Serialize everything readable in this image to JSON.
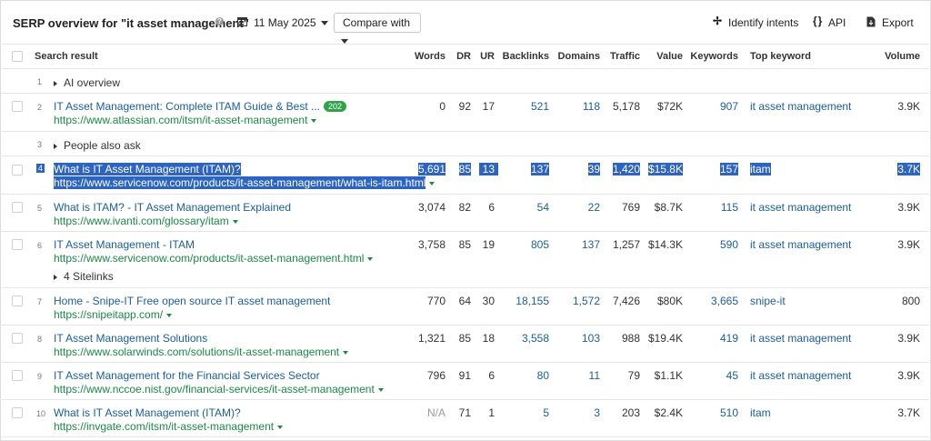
{
  "header": {
    "title": "SERP overview for \"it asset management\"",
    "help_icon": "question-icon",
    "date": "11 May 2025",
    "compare_label": "Compare with",
    "identify_label": "Identify intents",
    "api_label": "API",
    "export_label": "Export"
  },
  "columns": {
    "search_result": "Search result",
    "words": "Words",
    "dr": "DR",
    "ur": "UR",
    "backlinks": "Backlinks",
    "domains": "Domains",
    "traffic": "Traffic",
    "value": "Value",
    "keywords": "Keywords",
    "top_keyword": "Top keyword",
    "volume": "Volume"
  },
  "rows": {
    "r1": {
      "pos": "1",
      "label": "AI overview"
    },
    "r2": {
      "pos": "2",
      "title": "IT Asset Management: Complete ITAM Guide & Best ...",
      "badge": "202",
      "url": "https://www.atlassian.com/itsm/it-asset-management",
      "words": "0",
      "dr": "92",
      "ur": "17",
      "backlinks": "521",
      "domains": "118",
      "traffic": "5,178",
      "value": "$72K",
      "keywords": "907",
      "top_keyword": "it asset management",
      "volume": "3.9K"
    },
    "r3": {
      "pos": "3",
      "label": "People also ask"
    },
    "r4": {
      "pos": "4",
      "title": "What is IT Asset Management (ITAM)?",
      "url": "https://www.servicenow.com/products/it-asset-management/what-is-itam.html",
      "words": "5,691",
      "dr": "85",
      "ur": "13",
      "backlinks": "137",
      "domains": "39",
      "traffic": "1,420",
      "value": "$15.8K",
      "keywords": "157",
      "top_keyword": "itam",
      "volume": "3.7K"
    },
    "r5": {
      "pos": "5",
      "title": "What is ITAM? - IT Asset Management Explained",
      "url": "https://www.ivanti.com/glossary/itam",
      "words": "3,074",
      "dr": "82",
      "ur": "6",
      "backlinks": "54",
      "domains": "22",
      "traffic": "769",
      "value": "$8.7K",
      "keywords": "115",
      "top_keyword": "it asset management",
      "volume": "3.9K"
    },
    "r6": {
      "pos": "6",
      "title": "IT Asset Management - ITAM",
      "url": "https://www.servicenow.com/products/it-asset-management.html",
      "sitelinks": "4 Sitelinks",
      "words": "3,758",
      "dr": "85",
      "ur": "19",
      "backlinks": "805",
      "domains": "137",
      "traffic": "1,257",
      "value": "$14.3K",
      "keywords": "590",
      "top_keyword": "it asset management",
      "volume": "3.9K"
    },
    "r7": {
      "pos": "7",
      "title": "Home - Snipe-IT Free open source IT asset management",
      "url": "https://snipeitapp.com/",
      "words": "770",
      "dr": "64",
      "ur": "30",
      "backlinks": "18,155",
      "domains": "1,572",
      "traffic": "7,426",
      "value": "$80K",
      "keywords": "3,665",
      "top_keyword": "snipe-it",
      "volume": "800"
    },
    "r8": {
      "pos": "8",
      "title": "IT Asset Management Solutions",
      "url": "https://www.solarwinds.com/solutions/it-asset-management",
      "words": "1,321",
      "dr": "85",
      "ur": "18",
      "backlinks": "3,558",
      "domains": "103",
      "traffic": "988",
      "value": "$19.4K",
      "keywords": "419",
      "top_keyword": "it asset management",
      "volume": "3.9K"
    },
    "r9": {
      "pos": "9",
      "title": "IT Asset Management for the Financial Services Sector",
      "url": "https://www.nccoe.nist.gov/financial-services/it-asset-management",
      "words": "796",
      "dr": "91",
      "ur": "6",
      "backlinks": "80",
      "domains": "11",
      "traffic": "79",
      "value": "$1.1K",
      "keywords": "45",
      "top_keyword": "it asset management",
      "volume": "3.9K"
    },
    "r10": {
      "pos": "10",
      "title": "What is IT Asset Management (ITAM)?",
      "url": "https://invgate.com/itsm/it-asset-management",
      "words": "N/A",
      "dr": "71",
      "ur": "1",
      "backlinks": "5",
      "domains": "3",
      "traffic": "203",
      "value": "$2.4K",
      "keywords": "510",
      "top_keyword": "itam",
      "volume": "3.7K"
    }
  }
}
